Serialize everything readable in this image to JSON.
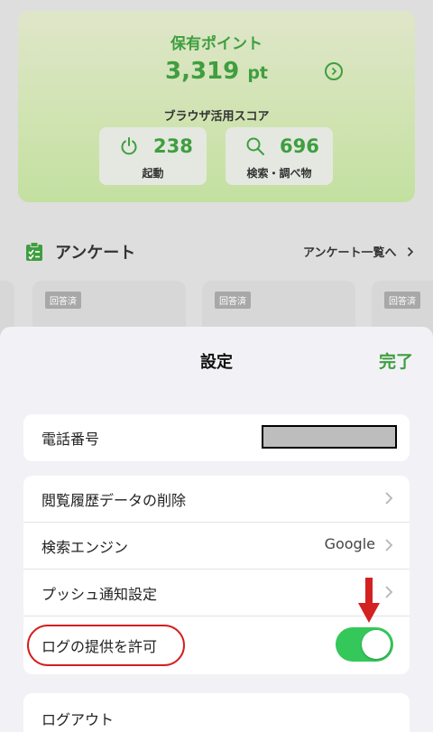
{
  "points": {
    "title": "保有ポイント",
    "value": "3,319",
    "unit": "pt",
    "score_title": "ブラウザ活用スコア",
    "stats": [
      {
        "icon": "power-icon",
        "value": "238",
        "label": "起動"
      },
      {
        "icon": "search-icon",
        "value": "696",
        "label": "検索・調べ物"
      }
    ]
  },
  "survey": {
    "title": "アンケート",
    "link": "アンケート一覧へ",
    "badge": "回答済"
  },
  "settings": {
    "title": "設定",
    "done": "完了",
    "phone_label": "電話番号",
    "items": [
      {
        "label": "閲覧履歴データの削除",
        "value": ""
      },
      {
        "label": "検索エンジン",
        "value": "Google"
      },
      {
        "label": "プッシュ通知設定",
        "value": ""
      },
      {
        "label": "ログの提供を許可",
        "value": ""
      }
    ],
    "logout": "ログアウト",
    "log_toggle_on": true
  },
  "colors": {
    "accent": "#3f9e3f",
    "toggle_on": "#34c759",
    "annotation": "#d32020"
  }
}
